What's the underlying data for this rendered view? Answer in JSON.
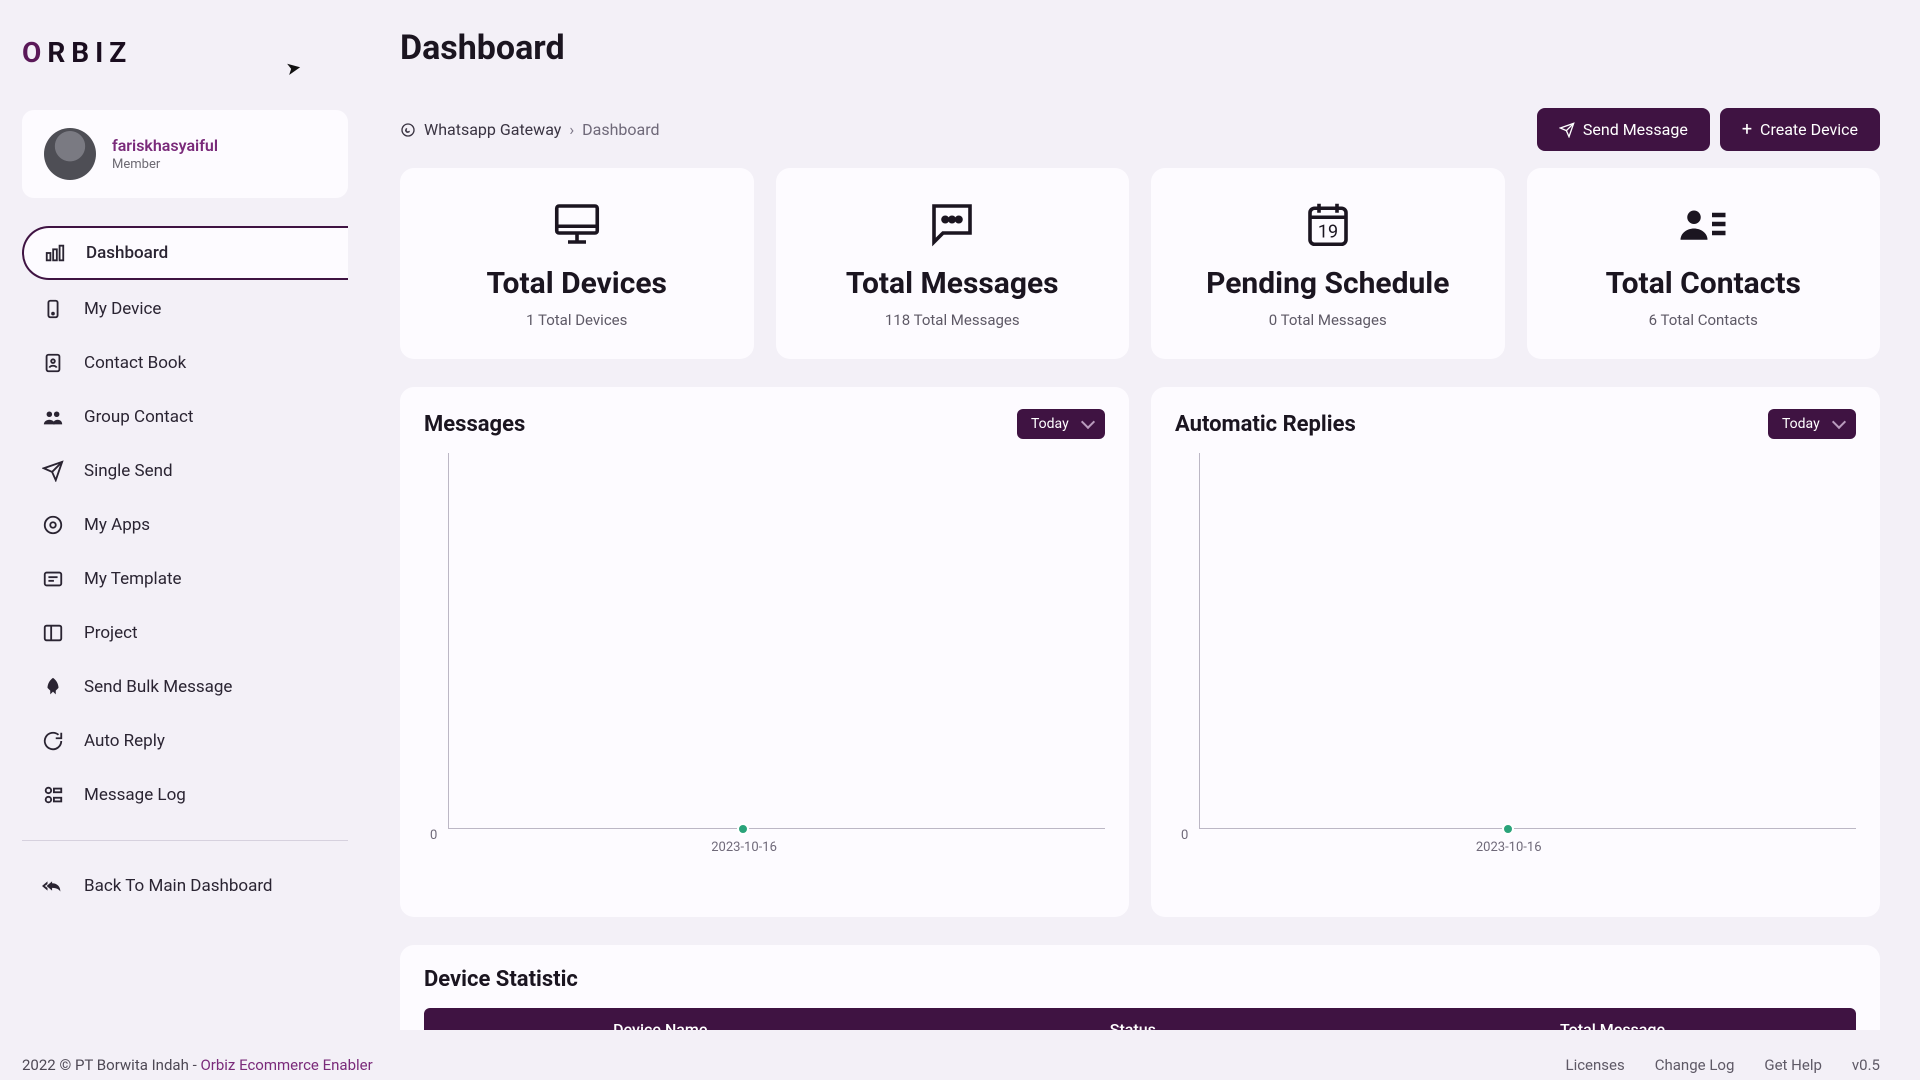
{
  "brand": {
    "name_rest": "RBIZ"
  },
  "user": {
    "name": "fariskhasyaiful",
    "role": "Member"
  },
  "sidebar": {
    "items": [
      {
        "label": "Dashboard"
      },
      {
        "label": "My Device"
      },
      {
        "label": "Contact Book"
      },
      {
        "label": "Group Contact"
      },
      {
        "label": "Single Send"
      },
      {
        "label": "My Apps"
      },
      {
        "label": "My Template"
      },
      {
        "label": "Project"
      },
      {
        "label": "Send Bulk Message"
      },
      {
        "label": "Auto Reply"
      },
      {
        "label": "Message Log"
      }
    ],
    "back": "Back To Main Dashboard"
  },
  "page": {
    "title": "Dashboard",
    "breadcrumb_root": "Whatsapp Gateway",
    "breadcrumb_current": "Dashboard"
  },
  "actions": {
    "send_message": "Send Message",
    "create_device": "Create Device"
  },
  "stats": [
    {
      "title": "Total Devices",
      "subtitle": "1 Total Devices"
    },
    {
      "title": "Total Messages",
      "subtitle": "118 Total Messages"
    },
    {
      "title": "Pending Schedule",
      "subtitle": "0 Total Messages",
      "date_num": "19"
    },
    {
      "title": "Total Contacts",
      "subtitle": "6 Total Contacts"
    }
  ],
  "charts": {
    "messages": {
      "title": "Messages",
      "range": "Today"
    },
    "replies": {
      "title": "Automatic Replies",
      "range": "Today"
    }
  },
  "device_stat": {
    "title": "Device Statistic",
    "columns": [
      "Device Name",
      "Status",
      "Total Message"
    ]
  },
  "footer": {
    "copyright": "2022 © PT Borwita Indah - ",
    "company_link": "Orbiz Ecommerce Enabler",
    "links": [
      "Licenses",
      "Change Log",
      "Get Help"
    ],
    "version": "v0.5"
  },
  "chart_data": [
    {
      "id": "messages",
      "type": "line",
      "title": "Messages",
      "categories": [
        "2023-10-16"
      ],
      "values": [
        0
      ],
      "ylim": [
        0,
        0
      ],
      "y_ticks": [
        0
      ]
    },
    {
      "id": "automatic_replies",
      "type": "line",
      "title": "Automatic Replies",
      "categories": [
        "2023-10-16"
      ],
      "values": [
        0
      ],
      "ylim": [
        0,
        0
      ],
      "y_ticks": [
        0
      ]
    }
  ]
}
